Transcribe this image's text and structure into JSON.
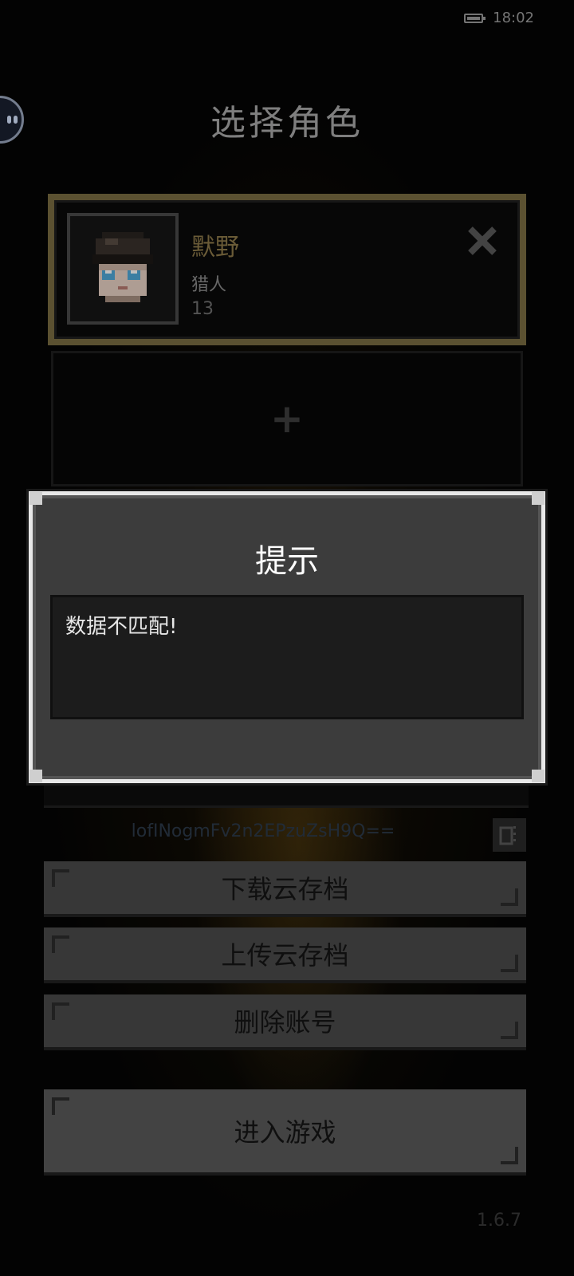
{
  "status_bar": {
    "time": "18:02",
    "battery_icon": "battery-icon",
    "battery_level": 0.8
  },
  "assistant": {
    "icon": "assistant-bubble-icon"
  },
  "page": {
    "title": "选择角色"
  },
  "character_slots": [
    {
      "name": "默野",
      "class": "猎人",
      "level": "13",
      "portrait_icon": "character-portrait",
      "delete_icon": "close-icon",
      "selected": true
    },
    {
      "empty": true,
      "add_icon": "plus-icon",
      "add_label": "+"
    }
  ],
  "account": {
    "id": "lofINogmFv2n2EPzuZsH9Q==",
    "copy_icon": "copy-icon"
  },
  "buttons": {
    "download": "下载云存档",
    "upload": "上传云存档",
    "delete_account": "删除账号",
    "enter_game": "进入游戏"
  },
  "version": "1.6.7",
  "dialog": {
    "title": "提示",
    "message": "数据不匹配!"
  },
  "colors": {
    "gold_border": "#7a6c42",
    "name_gold": "#8e7a4a",
    "dialog_bg": "#3c3c3c",
    "dialog_border": "#e8e8e8"
  }
}
